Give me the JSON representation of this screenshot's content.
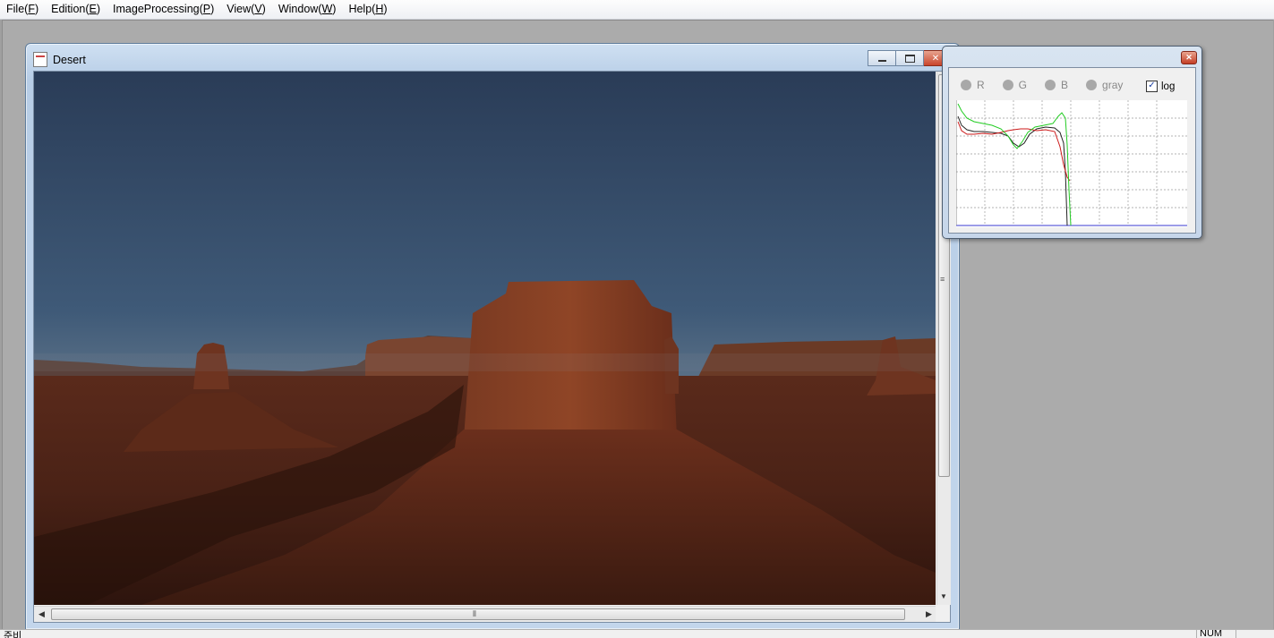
{
  "menu": {
    "items": [
      {
        "label": "File(",
        "key": "F",
        "suffix": ")"
      },
      {
        "label": "Edition(",
        "key": "E",
        "suffix": ")"
      },
      {
        "label": "ImageProcessing(",
        "key": "P",
        "suffix": ")"
      },
      {
        "label": "View(",
        "key": "V",
        "suffix": ")"
      },
      {
        "label": "Window(",
        "key": "W",
        "suffix": ")"
      },
      {
        "label": "Help(",
        "key": "H",
        "suffix": ")"
      }
    ]
  },
  "document": {
    "title": "Desert",
    "icon": "document-icon",
    "image_content": "desert-butte-landscape"
  },
  "histogram": {
    "channels": [
      "R",
      "G",
      "B",
      "gray"
    ],
    "log_label": "log",
    "log_checked": true,
    "curve_colors": {
      "red": "#cc1a1a",
      "green": "#22cc22",
      "black": "#222222"
    }
  },
  "status": {
    "left": "준비",
    "right": "NUM"
  }
}
